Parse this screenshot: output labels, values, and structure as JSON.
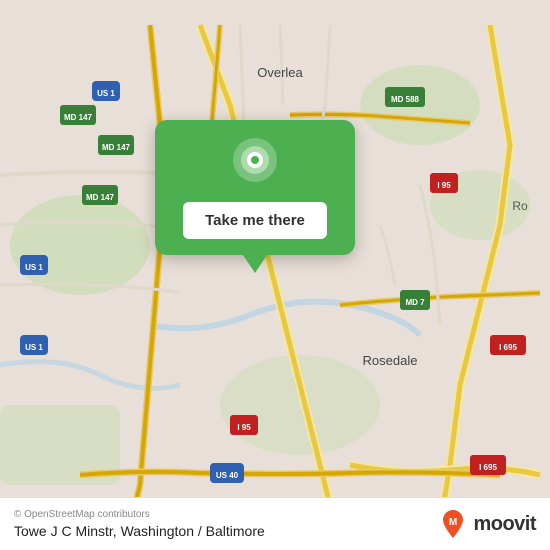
{
  "map": {
    "background_color": "#e8e0d8",
    "center_lat": 39.33,
    "center_lng": -76.54
  },
  "popup": {
    "button_label": "Take me there",
    "background_color": "#4caf50"
  },
  "bottom_bar": {
    "osm_credit": "© OpenStreetMap contributors",
    "location_name": "Towe J C Minstr, Washington / Baltimore",
    "moovit_label": "moovit"
  },
  "road_labels": {
    "us1_top": "US 1",
    "us1_left": "US 1",
    "us1_bottom_left": "US 1",
    "md147_top": "MD 147",
    "md147_mid": "MD 147",
    "md147_bottom": "MD 147",
    "md588": "MD 588",
    "i95_right": "I 95",
    "i95_mid": "I 95",
    "i95_bottom": "I 95",
    "i695_right": "I 695",
    "i695_bottom": "I 695",
    "md7": "MD 7",
    "us40": "US 40",
    "overlea": "Overlea",
    "rosedale": "Rosedale",
    "ro": "Ro"
  }
}
